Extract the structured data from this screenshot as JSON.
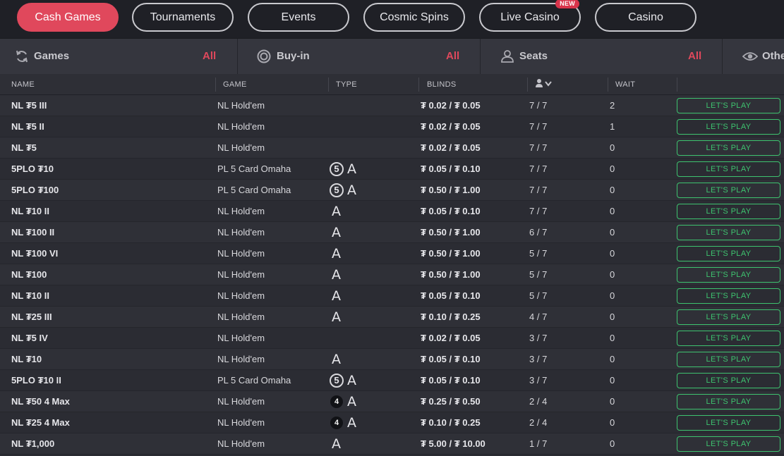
{
  "nav": {
    "tabs": [
      {
        "label": "Cash Games",
        "active": true
      },
      {
        "label": "Tournaments",
        "active": false
      },
      {
        "label": "Events",
        "active": false
      },
      {
        "label": "Cosmic Spins",
        "active": false
      },
      {
        "label": "Live Casino",
        "active": false,
        "badge": "NEW"
      },
      {
        "label": "Casino",
        "active": false
      }
    ]
  },
  "filters": [
    {
      "label": "Games",
      "value": "All",
      "icon": "refresh-icon"
    },
    {
      "label": "Buy-in",
      "value": "All",
      "icon": "chip-icon"
    },
    {
      "label": "Seats",
      "value": "All",
      "icon": "user-icon"
    },
    {
      "label": "Othe",
      "value": "",
      "icon": "eye-icon"
    }
  ],
  "table": {
    "headers": {
      "name": "NAME",
      "game": "GAME",
      "type": "TYPE",
      "blinds": "BLINDS",
      "wait": "WAIT"
    },
    "play_label": "LET'S PLAY",
    "rows": [
      {
        "name": "NL ₮5 III",
        "game": "NL  Hold'em",
        "type": [],
        "blinds": "₮ 0.02 / ₮ 0.05",
        "seats": "7 / 7",
        "wait": "2"
      },
      {
        "name": "NL ₮5 II",
        "game": "NL  Hold'em",
        "type": [],
        "blinds": "₮ 0.02 / ₮ 0.05",
        "seats": "7 / 7",
        "wait": "1"
      },
      {
        "name": "NL ₮5",
        "game": "NL  Hold'em",
        "type": [],
        "blinds": "₮ 0.02 / ₮ 0.05",
        "seats": "7 / 7",
        "wait": "0"
      },
      {
        "name": "5PLO ₮10",
        "game": "PL  5 Card Omaha",
        "type": [
          "5",
          "A"
        ],
        "blinds": "₮ 0.05 / ₮ 0.10",
        "seats": "7 / 7",
        "wait": "0"
      },
      {
        "name": "5PLO ₮100",
        "game": "PL  5 Card Omaha",
        "type": [
          "5",
          "A"
        ],
        "blinds": "₮ 0.50 / ₮ 1.00",
        "seats": "7 / 7",
        "wait": "0"
      },
      {
        "name": "NL ₮10 II",
        "game": "NL  Hold'em",
        "type": [
          "A"
        ],
        "blinds": "₮ 0.05 / ₮ 0.10",
        "seats": "7 / 7",
        "wait": "0"
      },
      {
        "name": "NL ₮100 II",
        "game": "NL  Hold'em",
        "type": [
          "A"
        ],
        "blinds": "₮ 0.50 / ₮ 1.00",
        "seats": "6 / 7",
        "wait": "0"
      },
      {
        "name": "NL ₮100 VI",
        "game": "NL  Hold'em",
        "type": [
          "A"
        ],
        "blinds": "₮ 0.50 / ₮ 1.00",
        "seats": "5 / 7",
        "wait": "0"
      },
      {
        "name": "NL ₮100",
        "game": "NL  Hold'em",
        "type": [
          "A"
        ],
        "blinds": "₮ 0.50 / ₮ 1.00",
        "seats": "5 / 7",
        "wait": "0"
      },
      {
        "name": "NL ₮10 II",
        "game": "NL  Hold'em",
        "type": [
          "A"
        ],
        "blinds": "₮ 0.05 / ₮ 0.10",
        "seats": "5 / 7",
        "wait": "0"
      },
      {
        "name": "NL ₮25 III",
        "game": "NL  Hold'em",
        "type": [
          "A"
        ],
        "blinds": "₮ 0.10 / ₮ 0.25",
        "seats": "4 / 7",
        "wait": "0"
      },
      {
        "name": "NL ₮5 IV",
        "game": "NL  Hold'em",
        "type": [],
        "blinds": "₮ 0.02 / ₮ 0.05",
        "seats": "3 / 7",
        "wait": "0"
      },
      {
        "name": "NL ₮10",
        "game": "NL  Hold'em",
        "type": [
          "A"
        ],
        "blinds": "₮ 0.05 / ₮ 0.10",
        "seats": "3 / 7",
        "wait": "0"
      },
      {
        "name": "5PLO ₮10 II",
        "game": "PL  5 Card Omaha",
        "type": [
          "5",
          "A"
        ],
        "blinds": "₮ 0.05 / ₮ 0.10",
        "seats": "3 / 7",
        "wait": "0"
      },
      {
        "name": "NL ₮50 4 Max",
        "game": "NL  Hold'em",
        "type": [
          "4",
          "A"
        ],
        "blinds": "₮ 0.25 / ₮ 0.50",
        "seats": "2 / 4",
        "wait": "0"
      },
      {
        "name": "NL ₮25 4 Max",
        "game": "NL  Hold'em",
        "type": [
          "4",
          "A"
        ],
        "blinds": "₮ 0.10 / ₮ 0.25",
        "seats": "2 / 4",
        "wait": "0"
      },
      {
        "name": "NL ₮1,000",
        "game": "NL  Hold'em",
        "type": [
          "A"
        ],
        "blinds": "₮ 5.00 / ₮ 10.00",
        "seats": "1 / 7",
        "wait": "0"
      }
    ]
  },
  "colors": {
    "accent": "#e0485c",
    "play": "#3ec36f"
  }
}
